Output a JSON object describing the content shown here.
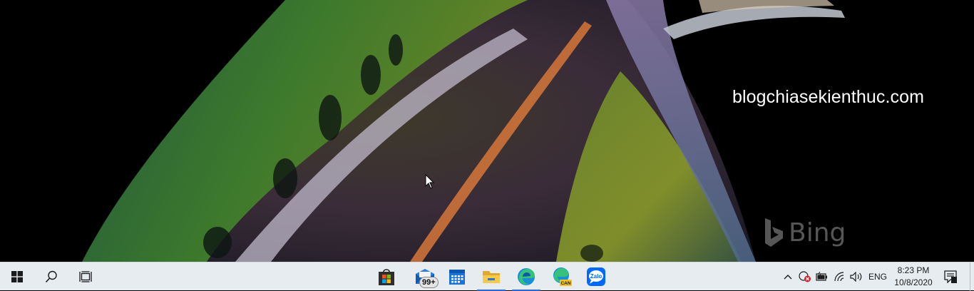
{
  "desktop": {
    "watermark_text": "blogchiasekienthuc.com",
    "wallpaper_logo_text": "Bing"
  },
  "taskbar": {
    "start_icon": "windows-logo-icon",
    "search_icon": "search-icon",
    "task_view_icon": "task-view-icon",
    "apps": [
      {
        "name": "Microsoft Store",
        "icon": "store-icon",
        "running": false
      },
      {
        "name": "Mail",
        "icon": "mail-icon",
        "badge": "99+",
        "running": false
      },
      {
        "name": "Calendar",
        "icon": "calendar-icon",
        "running": false
      },
      {
        "name": "File Explorer",
        "icon": "folder-icon",
        "running": true
      },
      {
        "name": "Microsoft Edge",
        "icon": "edge-icon",
        "running": true
      },
      {
        "name": "Microsoft Edge Canary",
        "icon": "edge-canary-icon",
        "label": "CAN",
        "running": false
      },
      {
        "name": "Zalo",
        "icon": "zalo-icon",
        "label": "Zalo",
        "running": false
      }
    ],
    "tray": {
      "chevron_icon": "chevron-up-icon",
      "language": "ENG",
      "time": "8:23 PM",
      "date": "10/8/2020"
    }
  },
  "colors": {
    "taskbar_bg": "#e6ecef",
    "accent": "#2a6bd1"
  }
}
